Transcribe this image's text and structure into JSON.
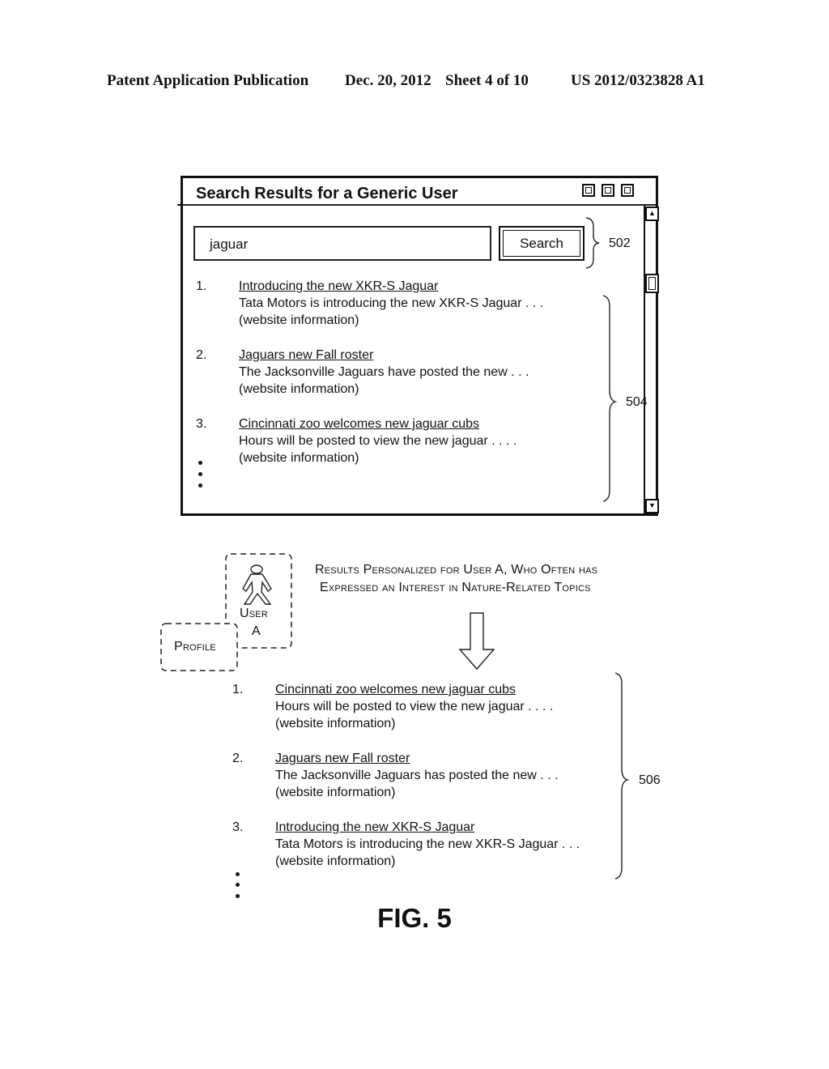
{
  "header": {
    "publication": "Patent Application Publication",
    "date": "Dec. 20, 2012",
    "sheet": "Sheet 4 of 10",
    "number": "US 2012/0323828 A1"
  },
  "window": {
    "title": "Search Results for a Generic User",
    "controls": [
      "minimize-icon",
      "maximize-icon",
      "close-icon"
    ],
    "search": {
      "value": "jaguar",
      "button_label": "Search"
    },
    "scrollbar": {
      "up_glyph": "▲",
      "down_glyph": "▼"
    },
    "results": [
      {
        "number": "1.",
        "title": "Introducing the new XKR-S Jaguar",
        "snippet": "Tata Motors is introducing the new XKR-S Jaguar . . .",
        "info": "(website information)"
      },
      {
        "number": "2.",
        "title": "Jaguars new Fall roster",
        "snippet": "The Jacksonville Jaguars have posted the new  . . .",
        "info": "(website information)"
      },
      {
        "number": "3.",
        "title": "Cincinnati zoo welcomes new jaguar cubs",
        "snippet": "Hours will be posted to view the new jaguar  . . . .",
        "info": "(website information)"
      }
    ]
  },
  "refs": {
    "search_area": "502",
    "generic_results": "504",
    "personalized_results": "506"
  },
  "user_profile": {
    "user_label_line1": "User",
    "user_label_line2": "A",
    "profile_label": "Profile",
    "icon": "person-icon"
  },
  "caption": {
    "line1": "Results Personalized for User A, Who Often has",
    "line2": "Expressed an Interest in Nature-Related Topics"
  },
  "personalized_results": [
    {
      "number": "1.",
      "title": "Cincinnati zoo welcomes new jaguar cubs",
      "snippet": "Hours will be posted to view the new jaguar  . . . .",
      "info": "(website information)"
    },
    {
      "number": "2.",
      "title": "Jaguars new Fall roster",
      "snippet": "The Jacksonville Jaguars has posted the new  . . .",
      "info": "(website information)"
    },
    {
      "number": "3.",
      "title": "Introducing the new XKR-S Jaguar",
      "snippet": "Tata Motors is introducing the new XKR-S Jaguar . . .",
      "info": "(website information)"
    }
  ],
  "figure_label": "FIG. 5"
}
